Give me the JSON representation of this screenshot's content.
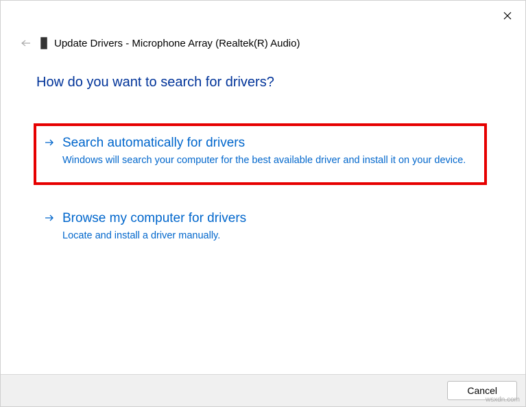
{
  "window": {
    "title": "Update Drivers - Microphone Array (Realtek(R) Audio)"
  },
  "heading": "How do you want to search for drivers?",
  "options": [
    {
      "title": "Search automatically for drivers",
      "description": "Windows will search your computer for the best available driver and install it on your device.",
      "highlighted": true
    },
    {
      "title": "Browse my computer for drivers",
      "description": "Locate and install a driver manually.",
      "highlighted": false
    }
  ],
  "buttons": {
    "cancel": "Cancel"
  },
  "watermark": "wsxdn.com"
}
